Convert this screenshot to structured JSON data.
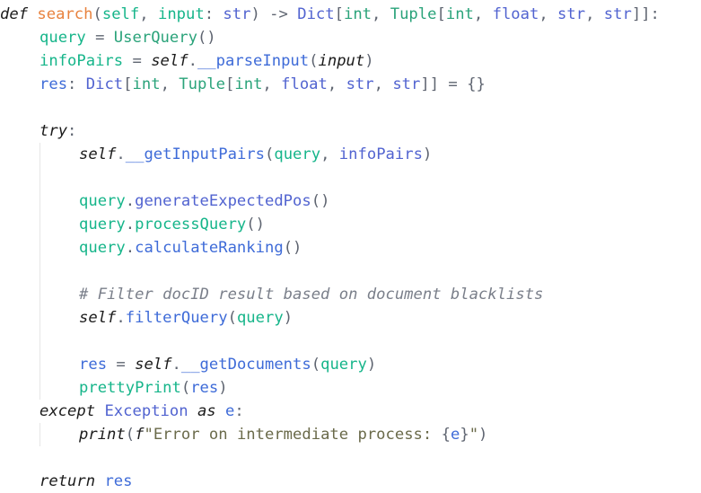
{
  "editor": {
    "language": "python",
    "colors": {
      "background": "#ffffff",
      "keyword": "#1b1b1b",
      "function": "#e8823e",
      "parameter": "#16b58a",
      "type": "#2aa37a",
      "method": "#3e6bd8",
      "comment": "#7a7f8a",
      "string": "#6a6a4a"
    },
    "lines": [
      {
        "indent": 0,
        "tokens": [
          {
            "t": "def",
            "c": "keyword"
          },
          {
            "t": " ",
            "c": "plain"
          },
          {
            "t": "search",
            "c": "func"
          },
          {
            "t": "(",
            "c": "punct"
          },
          {
            "t": "self",
            "c": "param"
          },
          {
            "t": ", ",
            "c": "punct"
          },
          {
            "t": "input",
            "c": "param"
          },
          {
            "t": ": ",
            "c": "punct"
          },
          {
            "t": "str",
            "c": "type2"
          },
          {
            "t": ") -> ",
            "c": "punct"
          },
          {
            "t": "Dict",
            "c": "type2"
          },
          {
            "t": "[",
            "c": "punct"
          },
          {
            "t": "int",
            "c": "type"
          },
          {
            "t": ", ",
            "c": "punct"
          },
          {
            "t": "Tuple",
            "c": "type"
          },
          {
            "t": "[",
            "c": "punct"
          },
          {
            "t": "int",
            "c": "type"
          },
          {
            "t": ", ",
            "c": "punct"
          },
          {
            "t": "float",
            "c": "type2"
          },
          {
            "t": ", ",
            "c": "punct"
          },
          {
            "t": "str",
            "c": "type2"
          },
          {
            "t": ", ",
            "c": "punct"
          },
          {
            "t": "str",
            "c": "type2"
          },
          {
            "t": "]]:",
            "c": "punct"
          }
        ]
      },
      {
        "indent": 1,
        "tokens": [
          {
            "t": "query",
            "c": "var"
          },
          {
            "t": " = ",
            "c": "punct"
          },
          {
            "t": "UserQuery",
            "c": "type"
          },
          {
            "t": "()",
            "c": "punct"
          }
        ]
      },
      {
        "indent": 1,
        "tokens": [
          {
            "t": "infoPairs",
            "c": "var"
          },
          {
            "t": " = ",
            "c": "punct"
          },
          {
            "t": "self",
            "c": "self"
          },
          {
            "t": ".",
            "c": "punct"
          },
          {
            "t": "__parseInput",
            "c": "method"
          },
          {
            "t": "(",
            "c": "punct"
          },
          {
            "t": "input",
            "c": "self"
          },
          {
            "t": ")",
            "c": "punct"
          }
        ]
      },
      {
        "indent": 1,
        "tokens": [
          {
            "t": "res",
            "c": "var2"
          },
          {
            "t": ": ",
            "c": "punct"
          },
          {
            "t": "Dict",
            "c": "type2"
          },
          {
            "t": "[",
            "c": "punct"
          },
          {
            "t": "int",
            "c": "type"
          },
          {
            "t": ", ",
            "c": "punct"
          },
          {
            "t": "Tuple",
            "c": "type"
          },
          {
            "t": "[",
            "c": "punct"
          },
          {
            "t": "int",
            "c": "type"
          },
          {
            "t": ", ",
            "c": "punct"
          },
          {
            "t": "float",
            "c": "type2"
          },
          {
            "t": ", ",
            "c": "punct"
          },
          {
            "t": "str",
            "c": "type2"
          },
          {
            "t": ", ",
            "c": "punct"
          },
          {
            "t": "str",
            "c": "type2"
          },
          {
            "t": "]] = {}",
            "c": "punct"
          }
        ]
      },
      {
        "indent": 0,
        "tokens": []
      },
      {
        "indent": 1,
        "tokens": [
          {
            "t": "try",
            "c": "keyword"
          },
          {
            "t": ":",
            "c": "punct"
          }
        ]
      },
      {
        "indent": 2,
        "tokens": [
          {
            "t": "self",
            "c": "self"
          },
          {
            "t": ".",
            "c": "punct"
          },
          {
            "t": "__getInputPairs",
            "c": "method"
          },
          {
            "t": "(",
            "c": "punct"
          },
          {
            "t": "query",
            "c": "var"
          },
          {
            "t": ", ",
            "c": "punct"
          },
          {
            "t": "infoPairs",
            "c": "type2"
          },
          {
            "t": ")",
            "c": "punct"
          }
        ]
      },
      {
        "indent": 0,
        "tokens": []
      },
      {
        "indent": 2,
        "tokens": [
          {
            "t": "query",
            "c": "var"
          },
          {
            "t": ".",
            "c": "punct"
          },
          {
            "t": "generateExpectedPos",
            "c": "type2"
          },
          {
            "t": "()",
            "c": "punct"
          }
        ]
      },
      {
        "indent": 2,
        "tokens": [
          {
            "t": "query",
            "c": "var"
          },
          {
            "t": ".",
            "c": "punct"
          },
          {
            "t": "processQuery",
            "c": "var"
          },
          {
            "t": "()",
            "c": "punct"
          }
        ]
      },
      {
        "indent": 2,
        "tokens": [
          {
            "t": "query",
            "c": "var"
          },
          {
            "t": ".",
            "c": "punct"
          },
          {
            "t": "calculateRanking",
            "c": "method"
          },
          {
            "t": "()",
            "c": "punct"
          }
        ]
      },
      {
        "indent": 0,
        "tokens": []
      },
      {
        "indent": 2,
        "tokens": [
          {
            "t": "# Filter docID result based on document blacklists",
            "c": "comment"
          }
        ]
      },
      {
        "indent": 2,
        "tokens": [
          {
            "t": "self",
            "c": "self"
          },
          {
            "t": ".",
            "c": "punct"
          },
          {
            "t": "filterQuery",
            "c": "method"
          },
          {
            "t": "(",
            "c": "punct"
          },
          {
            "t": "query",
            "c": "var"
          },
          {
            "t": ")",
            "c": "punct"
          }
        ]
      },
      {
        "indent": 0,
        "tokens": []
      },
      {
        "indent": 2,
        "tokens": [
          {
            "t": "res",
            "c": "var2"
          },
          {
            "t": " = ",
            "c": "punct"
          },
          {
            "t": "self",
            "c": "self"
          },
          {
            "t": ".",
            "c": "punct"
          },
          {
            "t": "__getDocuments",
            "c": "method"
          },
          {
            "t": "(",
            "c": "punct"
          },
          {
            "t": "query",
            "c": "var"
          },
          {
            "t": ")",
            "c": "punct"
          }
        ]
      },
      {
        "indent": 2,
        "tokens": [
          {
            "t": "prettyPrint",
            "c": "var"
          },
          {
            "t": "(",
            "c": "punct"
          },
          {
            "t": "res",
            "c": "var2"
          },
          {
            "t": ")",
            "c": "punct"
          }
        ]
      },
      {
        "indent": 1,
        "tokens": [
          {
            "t": "except",
            "c": "keyword"
          },
          {
            "t": " ",
            "c": "plain"
          },
          {
            "t": "Exception",
            "c": "type2"
          },
          {
            "t": " ",
            "c": "plain"
          },
          {
            "t": "as",
            "c": "keyword"
          },
          {
            "t": " ",
            "c": "plain"
          },
          {
            "t": "e",
            "c": "var2"
          },
          {
            "t": ":",
            "c": "punct"
          }
        ]
      },
      {
        "indent": 2,
        "tokens": [
          {
            "t": "print",
            "c": "self"
          },
          {
            "t": "(",
            "c": "punct"
          },
          {
            "t": "f",
            "c": "self"
          },
          {
            "t": "\"Error on intermediate process: ",
            "c": "string"
          },
          {
            "t": "{",
            "c": "punct"
          },
          {
            "t": "e",
            "c": "var2"
          },
          {
            "t": "}",
            "c": "punct"
          },
          {
            "t": "\"",
            "c": "string"
          },
          {
            "t": ")",
            "c": "punct"
          }
        ]
      },
      {
        "indent": 0,
        "tokens": []
      },
      {
        "indent": 1,
        "tokens": [
          {
            "t": "return",
            "c": "keyword"
          },
          {
            "t": " ",
            "c": "plain"
          },
          {
            "t": "res",
            "c": "var2"
          }
        ]
      }
    ]
  }
}
